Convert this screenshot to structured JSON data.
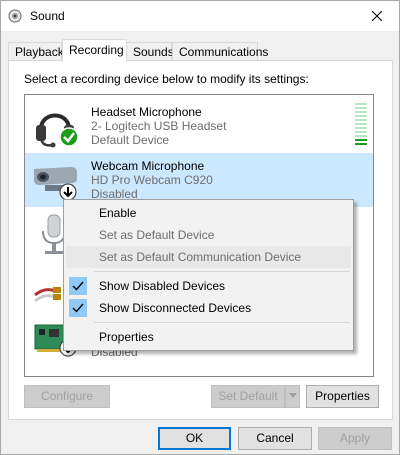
{
  "window": {
    "title": "Sound"
  },
  "tabs": [
    {
      "label": "Playback"
    },
    {
      "label": "Recording"
    },
    {
      "label": "Sounds"
    },
    {
      "label": "Communications"
    }
  ],
  "panel": {
    "instruction": "Select a recording device below to modify its settings:"
  },
  "devices": [
    {
      "name": "Headset Microphone",
      "line1": "2- Logitech USB Headset",
      "line2": "Default Device",
      "badge": "default-check",
      "level": 0.15
    },
    {
      "name": "Webcam Microphone",
      "line1": "HD Pro Webcam C920",
      "line2": "Disabled",
      "badge": "disabled-arrow"
    },
    {
      "name": "",
      "line1": "",
      "line2": "Disabled",
      "badge": "disabled-arrow"
    }
  ],
  "context_menu": {
    "items": [
      {
        "label": "Enable",
        "enabled": true
      },
      {
        "label": "Set as Default Device",
        "enabled": false
      },
      {
        "label": "Set as Default Communication Device",
        "enabled": false
      },
      {
        "label": "Show Disabled Devices",
        "checked": true
      },
      {
        "label": "Show Disconnected Devices",
        "checked": true
      },
      {
        "label": "Properties",
        "enabled": true
      }
    ]
  },
  "buttons": {
    "configure": "Configure",
    "set_default": "Set Default",
    "properties": "Properties",
    "ok": "OK",
    "cancel": "Cancel",
    "apply": "Apply"
  },
  "colors": {
    "selection": "#cce8ff",
    "accent": "#0078d7",
    "check_green": "#1a9e1a"
  }
}
